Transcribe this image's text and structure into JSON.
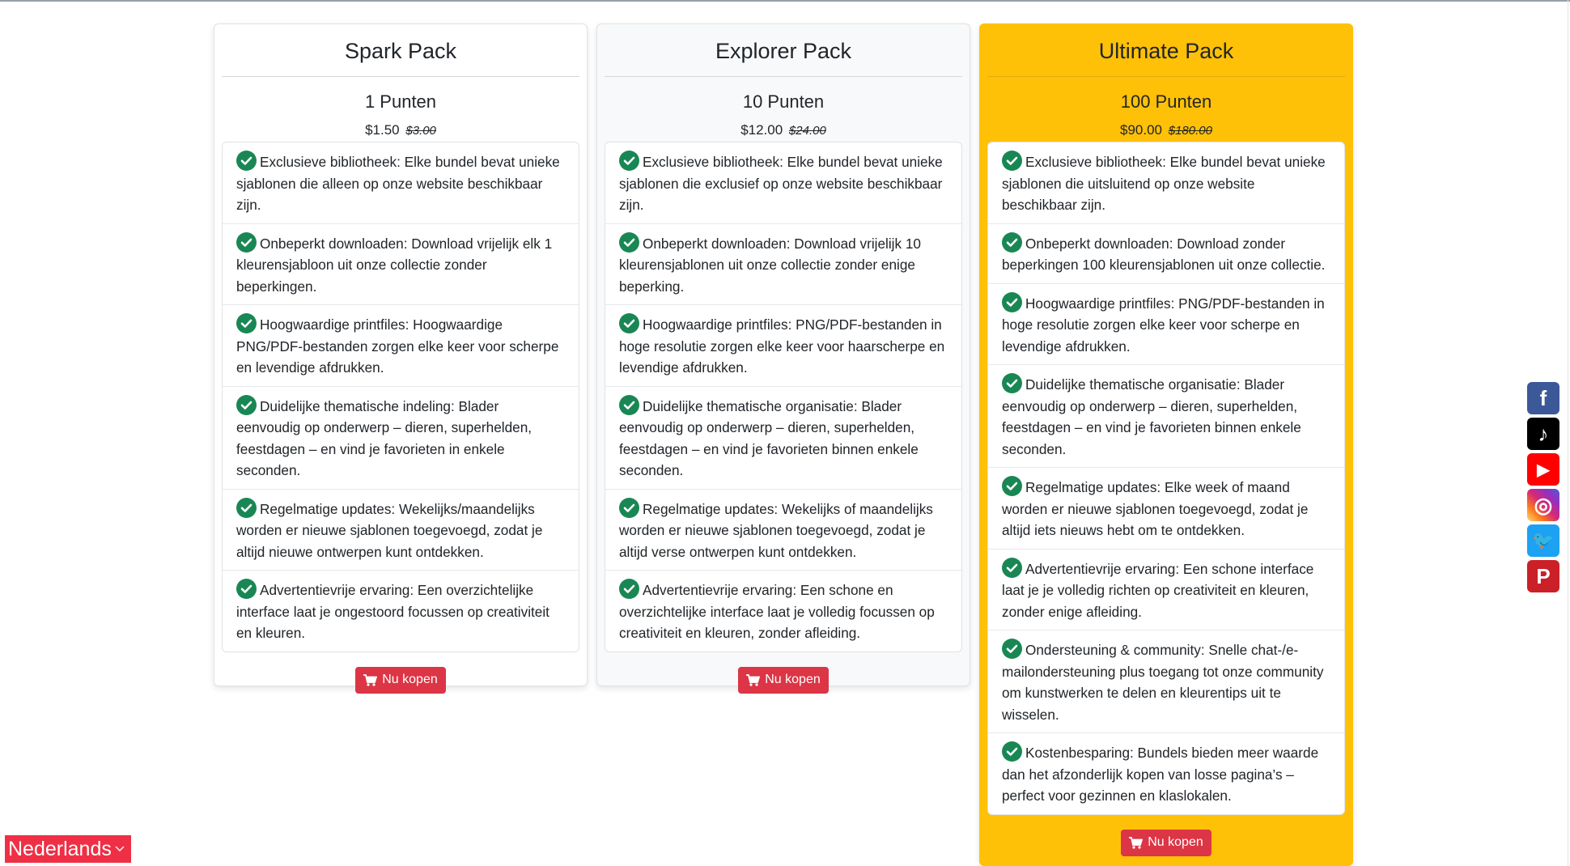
{
  "packs": [
    {
      "title": "Spark Pack",
      "points": "1 Punten",
      "price": "$1.50",
      "old_price": "$3.00",
      "features": [
        "Exclusieve bibliotheek: Elke bundel bevat unieke sjablonen die alleen op onze website beschikbaar zijn.",
        "Onbeperkt downloaden: Download vrijelijk elk 1 kleurensjabloon uit onze collectie zonder beperkingen.",
        "Hoogwaardige printfiles: Hoogwaardige PNG/PDF-bestanden zorgen elke keer voor scherpe en levendige afdrukken.",
        "Duidelijke thematische indeling: Blader eenvoudig op onderwerp – dieren, superhelden, feestdagen – en vind je favorieten in enkele seconden.",
        "Regelmatige updates: Wekelijks/maandelijks worden er nieuwe sjablonen toegevoegd, zodat je altijd nieuwe ontwerpen kunt ontdekken.",
        "Advertentievrije ervaring: Een overzichtelijke interface laat je ongestoord focussen op creativiteit en kleuren."
      ],
      "button": "Nu kopen"
    },
    {
      "title": "Explorer Pack",
      "points": "10 Punten",
      "price": "$12.00",
      "old_price": "$24.00",
      "features": [
        "Exclusieve bibliotheek: Elke bundel bevat unieke sjablonen die exclusief op onze website beschikbaar zijn.",
        "Onbeperkt downloaden: Download vrijelijk 10 kleurensjablonen uit onze collectie zonder enige beperking.",
        "Hoogwaardige printfiles: PNG/PDF-bestanden in hoge resolutie zorgen elke keer voor haarscherpe en levendige afdrukken.",
        "Duidelijke thematische organisatie: Blader eenvoudig op onderwerp – dieren, superhelden, feestdagen – en vind je favorieten binnen enkele seconden.",
        "Regelmatige updates: Wekelijks of maandelijks worden er nieuwe sjablonen toegevoegd, zodat je altijd verse ontwerpen kunt ontdekken.",
        "Advertentievrije ervaring: Een schone en overzichtelijke interface laat je volledig focussen op creativiteit en kleuren, zonder afleiding."
      ],
      "button": "Nu kopen"
    },
    {
      "title": "Ultimate Pack",
      "points": "100 Punten",
      "price": "$90.00",
      "old_price": "$180.00",
      "features": [
        "Exclusieve bibliotheek: Elke bundel bevat unieke sjablonen die uitsluitend op onze website beschikbaar zijn.",
        "Onbeperkt downloaden: Download zonder beperkingen 100 kleurensjablonen uit onze collectie.",
        "Hoogwaardige printfiles: PNG/PDF-bestanden in hoge resolutie zorgen elke keer voor scherpe en levendige afdrukken.",
        "Duidelijke thematische organisatie: Blader eenvoudig op onderwerp – dieren, superhelden, feestdagen – en vind je favorieten binnen enkele seconden.",
        "Regelmatige updates: Elke week of maand worden er nieuwe sjablonen toegevoegd, zodat je altijd iets nieuws hebt om te ontdekken.",
        "Advertentievrije ervaring: Een schone interface laat je je volledig richten op creativiteit en kleuren, zonder enige afleiding.",
        "Ondersteuning & community: Snelle chat-/e-mailondersteuning plus toegang tot onze community om kunstwerken te delen en kleurentips uit te wisselen.",
        "Kostenbesparing: Bundels bieden meer waarde dan het afzonderlijk kopen van losse pagina’s – perfect voor gezinnen en klaslokalen."
      ],
      "button": "Nu kopen"
    }
  ],
  "social": [
    {
      "name": "facebook-icon",
      "glyph": "f",
      "color": "#3b5998"
    },
    {
      "name": "tiktok-icon",
      "glyph": "♪",
      "color": "#000000"
    },
    {
      "name": "youtube-icon",
      "glyph": "▶",
      "color": "#ff0000"
    },
    {
      "name": "instagram-icon",
      "glyph": "◎",
      "color": "#d6249f"
    },
    {
      "name": "twitter-icon",
      "glyph": "🐦",
      "color": "#1da1f2"
    },
    {
      "name": "pinterest-icon",
      "glyph": "P",
      "color": "#cb2027"
    }
  ],
  "language": {
    "label": "Nederlands"
  }
}
